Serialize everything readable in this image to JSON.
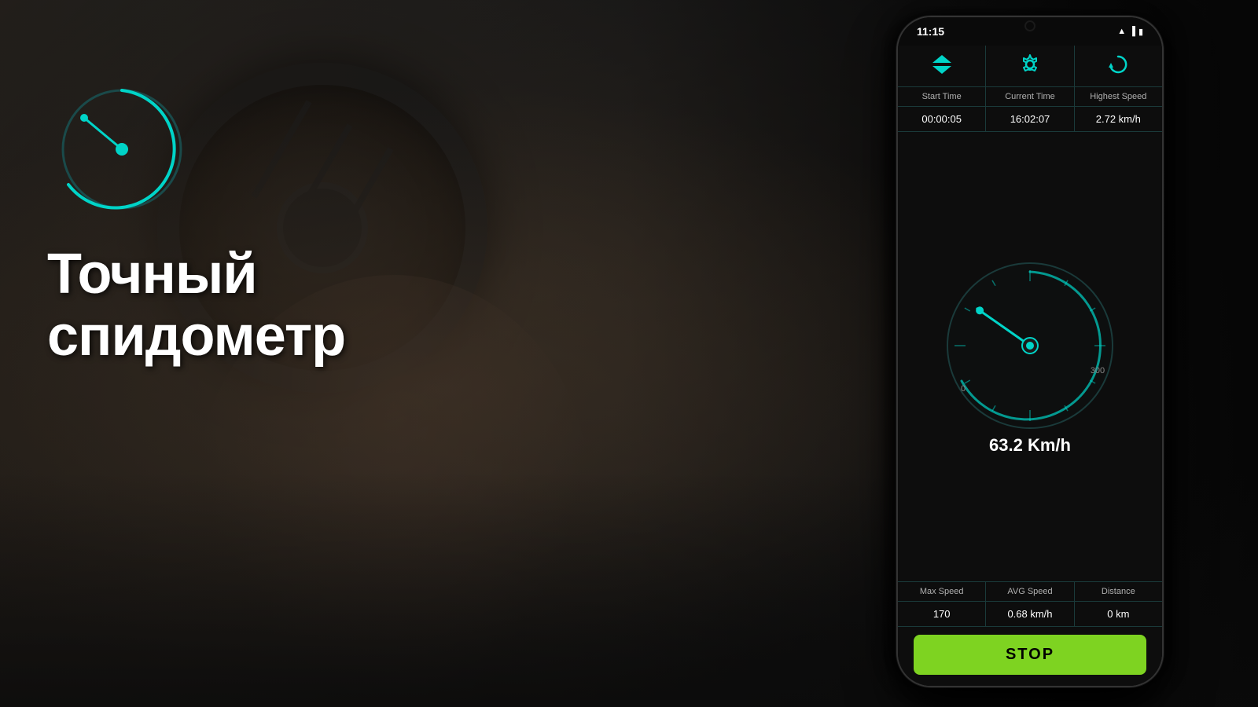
{
  "background": {
    "color": "#1a1a1a"
  },
  "overlay_text": {
    "line1": "Точный",
    "line2": "спидометр"
  },
  "phone": {
    "status_bar": {
      "time": "11:15",
      "icons": [
        "wifi",
        "signal",
        "battery"
      ]
    },
    "toolbar": {
      "buttons": [
        {
          "icon": "▼▲",
          "label": "start_stop_icon"
        },
        {
          "icon": "⚙",
          "label": "settings_icon"
        },
        {
          "icon": "↺",
          "label": "reset_icon"
        }
      ]
    },
    "stats_row": {
      "headers": [
        "Start Time",
        "Current Time",
        "Highest Speed"
      ],
      "values": [
        "00:00:05",
        "16:02:07",
        "2.72 km/h"
      ]
    },
    "speedometer": {
      "current_speed": "63.2 Km/h",
      "min_label": "0",
      "max_label": "300",
      "needle_angle": -60
    },
    "bottom_stats": {
      "headers": [
        "Max Speed",
        "AVG Speed",
        "Distance"
      ],
      "values": [
        "170",
        "0.68 km/h",
        "0 km"
      ]
    },
    "stop_button": {
      "label": "STOP",
      "color": "#7ed321"
    }
  }
}
